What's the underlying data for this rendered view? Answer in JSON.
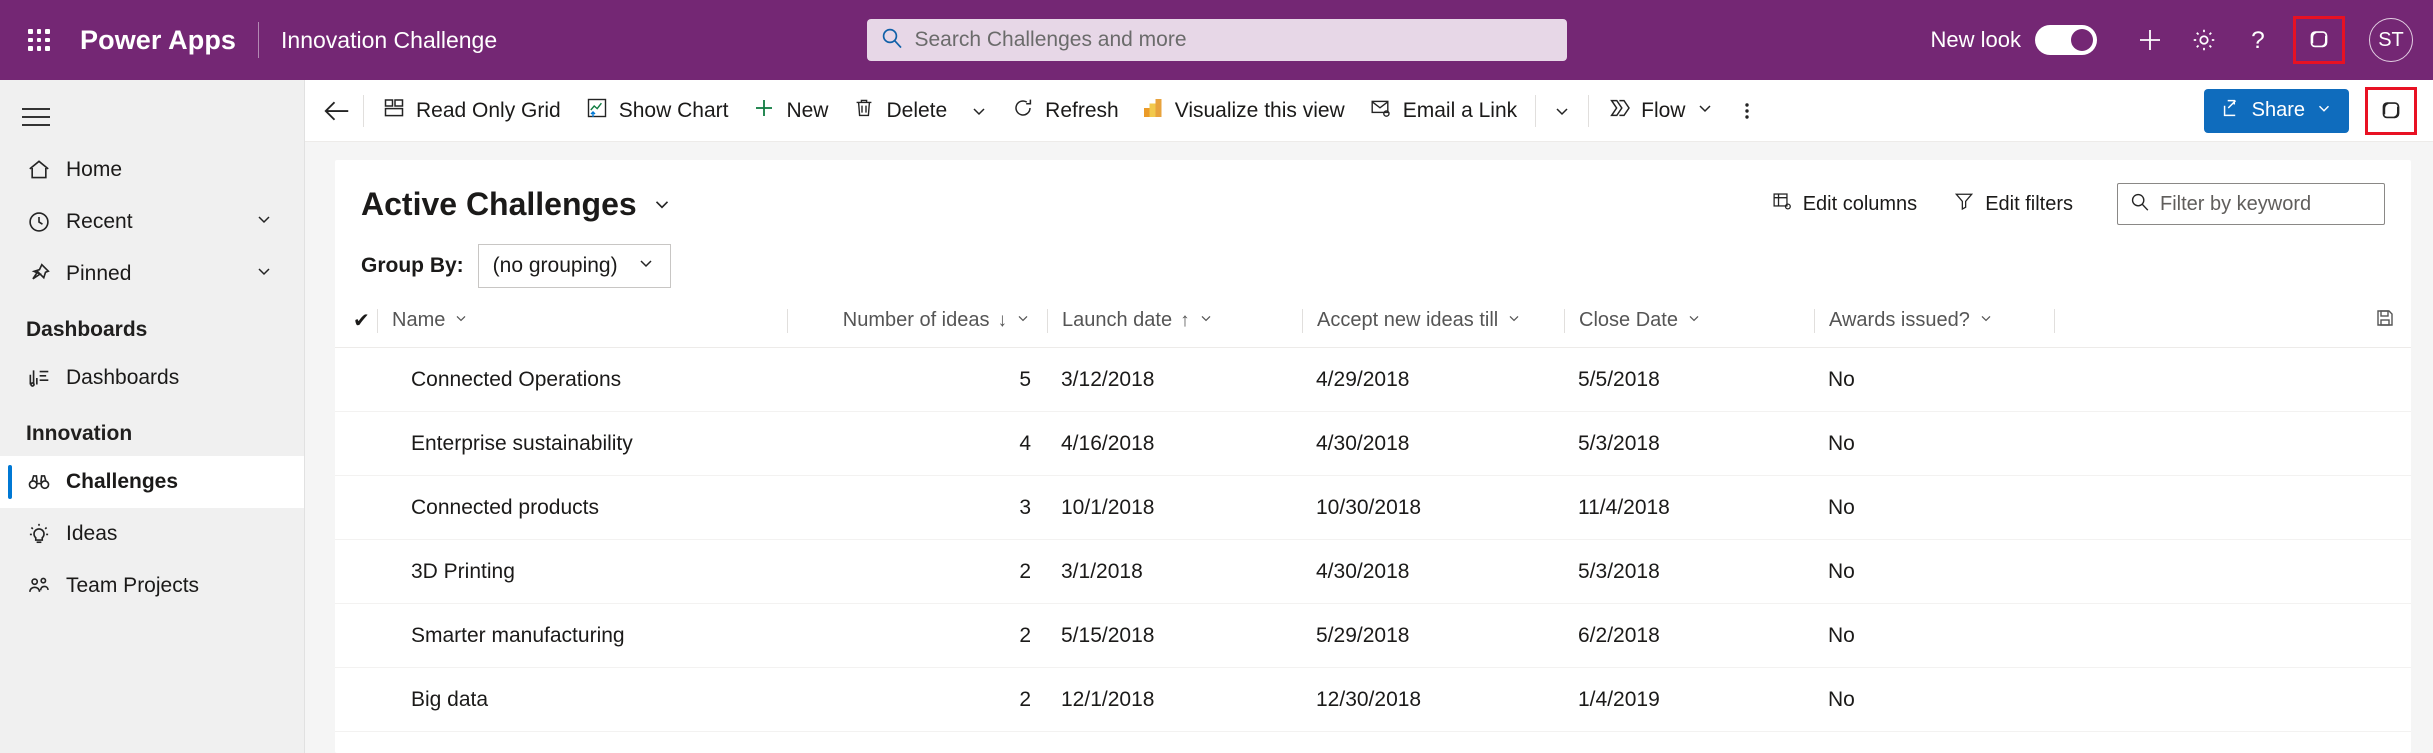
{
  "appbar": {
    "waffle_label": "app-launcher",
    "brand": "Power Apps",
    "app_name": "Innovation Challenge",
    "search_placeholder": "Search Challenges and more",
    "search_value": "",
    "new_look_label": "New look",
    "new_look_state": "on",
    "avatar_initials": "ST",
    "accent_purple": "#742774",
    "highlight_red": "#e81123"
  },
  "sidebar": {
    "items": [
      {
        "label": "Home",
        "icon": "home-icon",
        "selected": false,
        "has_chevron": false
      },
      {
        "label": "Recent",
        "icon": "clock-icon",
        "selected": false,
        "has_chevron": true
      },
      {
        "label": "Pinned",
        "icon": "pin-icon",
        "selected": false,
        "has_chevron": true
      }
    ],
    "groups": [
      {
        "title": "Dashboards",
        "items": [
          {
            "label": "Dashboards",
            "icon": "dashboard-icon",
            "selected": false
          }
        ]
      },
      {
        "title": "Innovation",
        "items": [
          {
            "label": "Challenges",
            "icon": "binoculars-icon",
            "selected": true
          },
          {
            "label": "Ideas",
            "icon": "lightbulb-icon",
            "selected": false
          },
          {
            "label": "Team Projects",
            "icon": "people-icon",
            "selected": false
          }
        ]
      }
    ]
  },
  "commandbar": {
    "back_label": "back-arrow",
    "items": [
      {
        "label": "Read Only Grid",
        "icon": "grid-icon"
      },
      {
        "label": "Show Chart",
        "icon": "chart-icon"
      },
      {
        "label": "New",
        "icon": "plus-icon"
      },
      {
        "label": "Delete",
        "icon": "trash-icon"
      },
      {
        "label": "Refresh",
        "icon": "refresh-icon"
      },
      {
        "label": "Visualize this view",
        "icon": "powerbi-icon"
      },
      {
        "label": "Email a Link",
        "icon": "mail-icon"
      },
      {
        "label": "Flow",
        "icon": "flow-icon"
      }
    ],
    "overflow_label": "More commands",
    "share_label": "Share",
    "share_color": "#0f6cbd",
    "copilot_label": "Copilot"
  },
  "view": {
    "title": "Active Challenges",
    "edit_columns_label": "Edit columns",
    "edit_filters_label": "Edit filters",
    "filter_placeholder": "Filter by keyword",
    "filter_value": "",
    "group_by_label": "Group By:",
    "group_by_value": "(no grouping)"
  },
  "table": {
    "columns": [
      {
        "key": "name",
        "label": "Name",
        "sort": "",
        "align": "left"
      },
      {
        "key": "ideas",
        "label": "Number of ideas",
        "sort": "desc",
        "align": "right"
      },
      {
        "key": "launch",
        "label": "Launch date",
        "sort": "asc",
        "align": "left"
      },
      {
        "key": "accept",
        "label": "Accept new ideas till",
        "sort": "",
        "align": "left"
      },
      {
        "key": "close",
        "label": "Close Date",
        "sort": "",
        "align": "left"
      },
      {
        "key": "awards",
        "label": "Awards issued?",
        "sort": "",
        "align": "left"
      }
    ],
    "sort_asc_glyph": "↑",
    "sort_desc_glyph": "↓",
    "save_icon_label": "save-view-icon",
    "rows": [
      {
        "name": "Connected Operations",
        "ideas": "5",
        "launch": "3/12/2018",
        "accept": "4/29/2018",
        "close": "5/5/2018",
        "awards": "No"
      },
      {
        "name": "Enterprise sustainability",
        "ideas": "4",
        "launch": "4/16/2018",
        "accept": "4/30/2018",
        "close": "5/3/2018",
        "awards": "No"
      },
      {
        "name": "Connected products",
        "ideas": "3",
        "launch": "10/1/2018",
        "accept": "10/30/2018",
        "close": "11/4/2018",
        "awards": "No"
      },
      {
        "name": "3D Printing",
        "ideas": "2",
        "launch": "3/1/2018",
        "accept": "4/30/2018",
        "close": "5/3/2018",
        "awards": "No"
      },
      {
        "name": "Smarter manufacturing",
        "ideas": "2",
        "launch": "5/15/2018",
        "accept": "5/29/2018",
        "close": "6/2/2018",
        "awards": "No"
      },
      {
        "name": "Big data",
        "ideas": "2",
        "launch": "12/1/2018",
        "accept": "12/30/2018",
        "close": "1/4/2019",
        "awards": "No"
      }
    ]
  }
}
